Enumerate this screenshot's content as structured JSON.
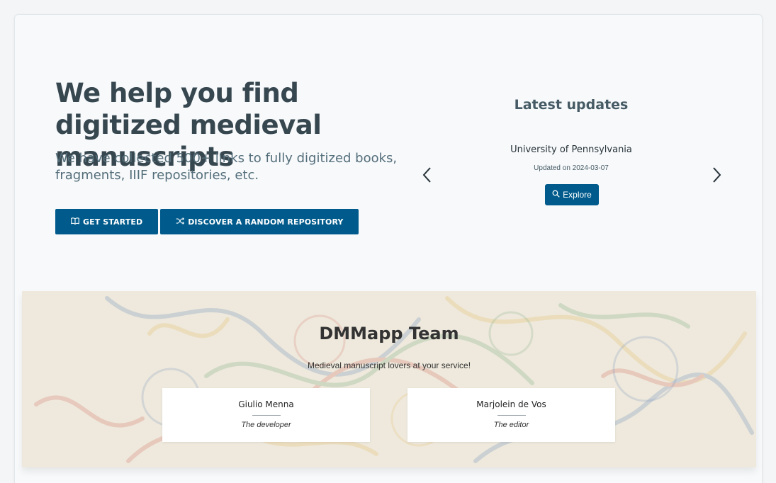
{
  "hero": {
    "title": "We help you find digitized medieval manuscripts",
    "subtitle": "We have collected 500+ links to fully digitized books, fragments, IIIF repositories, etc.",
    "buttons": [
      {
        "label": "GET STARTED",
        "icon": "book-icon"
      },
      {
        "label": "DISCOVER A RANDOM REPOSITORY",
        "icon": "shuffle-icon"
      }
    ]
  },
  "updates": {
    "title": "Latest updates",
    "current": {
      "name": "University of Pennsylvania",
      "date": "Updated on 2024-03-07",
      "button_label": "Explore",
      "button_icon": "search-icon"
    },
    "prev_icon": "chevron-left-icon",
    "next_icon": "chevron-right-icon"
  },
  "team": {
    "title": "DMMapp Team",
    "subtitle": "Medieval manuscript lovers at your service!",
    "members": [
      {
        "name": "Giulio Menna",
        "role": "The developer"
      },
      {
        "name": "Marjolein de Vos",
        "role": "The editor"
      }
    ]
  },
  "colors": {
    "accent": "#005b8c",
    "page_background": "#f7f9fb",
    "heading": "#37474f"
  }
}
